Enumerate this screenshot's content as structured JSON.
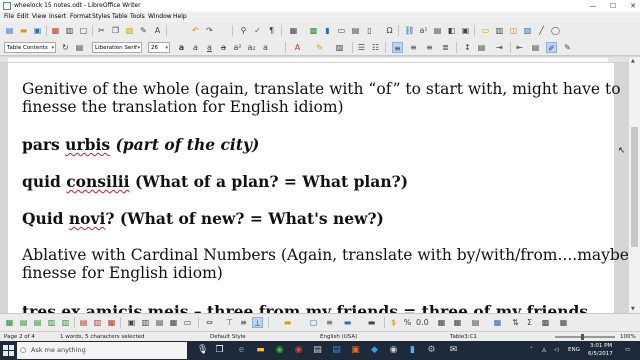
{
  "window": {
    "title": "wheelock 15 notes.odt - LibreOffice Writer",
    "controls": {
      "minimize": "—",
      "maximize": "☐",
      "close": "✕"
    }
  },
  "menu": [
    "File",
    "Edit",
    "View",
    "Insert",
    "Format",
    "Styles",
    "Table",
    "Tools",
    "Window",
    "Help"
  ],
  "formatting": {
    "paragraph_style": "Table Contents",
    "font_name": "Liberation Serif",
    "font_size": "26"
  },
  "document": {
    "paragraphs": [
      {
        "segments": [
          {
            "text": "Genitive of the whole (again, translate with “of” to start with, might have to"
          }
        ]
      },
      {
        "segments": [
          {
            "text": "finesse the translation for English idiom)"
          }
        ]
      },
      {
        "segments": [
          {
            "text": "pars "
          },
          {
            "text": "urbis",
            "spell": true
          },
          {
            "text": " "
          },
          {
            "text": "(part of the city)",
            "italic": true
          }
        ]
      },
      {
        "segments": [
          {
            "text": "quid "
          },
          {
            "text": "consilii",
            "spell": true
          },
          {
            "text": " (What of a plan? = What plan?)"
          }
        ]
      },
      {
        "segments": [
          {
            "text": "Quid "
          },
          {
            "text": "novi",
            "spell": true
          },
          {
            "text": "? (What of new? = What's new?)"
          }
        ]
      },
      {
        "segments": [
          {
            "text": "Ablative with Cardinal Numbers (Again, translate with by/with/from....maybe"
          }
        ]
      },
      {
        "segments": [
          {
            "text": "finesse for English idiom)"
          }
        ]
      },
      {
        "segments": [
          {
            "text": "tres ex amicis meis",
            "spell": true
          },
          {
            "text": " – three from my friends = three of my friends"
          }
        ]
      }
    ]
  },
  "status": {
    "page": "Page 2 of 4",
    "words": "1 words, 5 characters selected",
    "style": "Default Style",
    "language": "English (USA)",
    "table_cell": "Table3:C1",
    "zoom": "100%"
  },
  "taskbar": {
    "search_placeholder": "Ask me anything",
    "language_indicator": "ENG",
    "time": "3:01 PM",
    "date": "6/5/2017"
  }
}
